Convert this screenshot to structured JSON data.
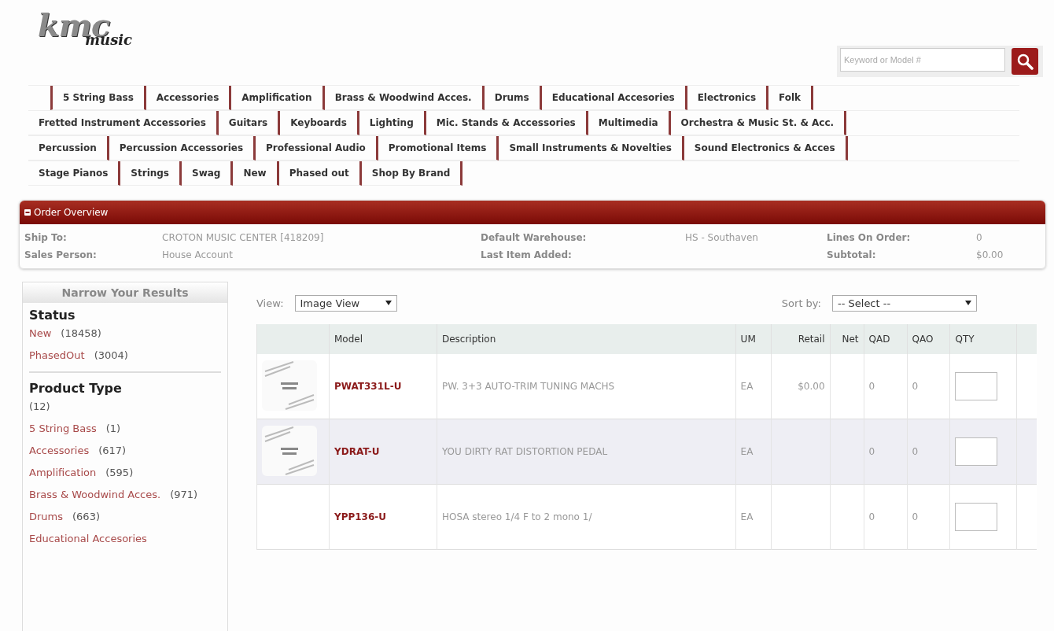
{
  "logo": {
    "main": "kmc",
    "sub": "music"
  },
  "search": {
    "placeholder": "Keyword or Model #"
  },
  "nav": {
    "items": [
      {
        "label": "5 String Bass",
        "new_line": true
      },
      {
        "label": "Accessories",
        "new_line": false
      },
      {
        "label": "Amplification",
        "new_line": false
      },
      {
        "label": "Brass & Woodwind Acces.",
        "new_line": false
      },
      {
        "label": "Drums",
        "new_line": false
      },
      {
        "label": "Educational Accesories",
        "new_line": false
      },
      {
        "label": "Electronics",
        "new_line": false
      },
      {
        "label": "Folk",
        "new_line": false
      },
      {
        "label": "Fretted Instrument Accessories",
        "new_line": true
      },
      {
        "label": "Guitars",
        "new_line": false
      },
      {
        "label": "Keyboards",
        "new_line": false
      },
      {
        "label": "Lighting",
        "new_line": false
      },
      {
        "label": "Mic. Stands & Accessories",
        "new_line": false
      },
      {
        "label": "Multimedia",
        "new_line": false
      },
      {
        "label": "Orchestra & Music St. & Acc.",
        "new_line": false
      },
      {
        "label": "Percussion",
        "new_line": true
      },
      {
        "label": "Percussion Accessories",
        "new_line": false
      },
      {
        "label": "Professional Audio",
        "new_line": false
      },
      {
        "label": "Promotional Items",
        "new_line": false
      },
      {
        "label": "Small Instruments & Novelties",
        "new_line": false
      },
      {
        "label": "Sound Electronics & Acces",
        "new_line": false
      },
      {
        "label": "Stage Pianos",
        "new_line": true
      },
      {
        "label": "Strings",
        "new_line": false
      },
      {
        "label": "Swag",
        "new_line": false
      },
      {
        "label": "New",
        "new_line": false
      },
      {
        "label": "Phased out",
        "new_line": false
      },
      {
        "label": "Shop By Brand",
        "new_line": false
      }
    ]
  },
  "order_overview": {
    "title": "Order Overview",
    "expanded": true,
    "fields": [
      {
        "label": "Ship To:",
        "value": "CROTON MUSIC CENTER [418209]"
      },
      {
        "label": "Default Warehouse:",
        "value": "HS - Southaven"
      },
      {
        "label": "Lines On Order:",
        "value": "0"
      },
      {
        "label": "Sales Person:",
        "value": "House Account"
      },
      {
        "label": "Last Item Added:"
      },
      {
        "label": "Subtotal:",
        "value": "$0.00"
      }
    ]
  },
  "sidebar": {
    "title": "Narrow Your Results",
    "groups": [
      {
        "heading": "Status",
        "items": [
          {
            "label": "New",
            "count": "(18458)"
          },
          {
            "label": "PhasedOut",
            "count": "(3004)"
          }
        ]
      },
      {
        "heading": "Product Type",
        "count": "(12)",
        "items": [
          {
            "label": "5 String Bass",
            "count": "(1)"
          },
          {
            "label": "Accessories",
            "count": "(617)"
          },
          {
            "label": "Amplification",
            "count": "(595)"
          },
          {
            "label": "Brass & Woodwind Acces.",
            "count": "(971)"
          },
          {
            "label": "Drums",
            "count": "(663)"
          },
          {
            "label": "Educational Accesories"
          }
        ]
      }
    ]
  },
  "toolbar": {
    "view_label": "View:",
    "view_value": "Image View",
    "sort_label": "Sort by:",
    "sort_value": "-- Select --"
  },
  "table": {
    "columns": [
      "",
      "Model",
      "Description",
      "UM",
      "Retail",
      "Net",
      "QAD",
      "QAO",
      "QTY",
      ""
    ],
    "rows": [
      {
        "thumbnail": true,
        "highlighted": false,
        "model": "PWAT331L-U",
        "description": "PW. 3+3 AUTO-TRIM TUNING MACHS",
        "um": "EA",
        "retail": "$0.00",
        "net": "",
        "qad": "0",
        "qao": "0"
      },
      {
        "thumbnail": true,
        "highlighted": true,
        "model": "YDRAT-U",
        "description": "YOU DIRTY RAT DISTORTION PEDAL",
        "um": "EA",
        "retail": "",
        "net": "",
        "qad": "0",
        "qao": "0"
      },
      {
        "thumbnail": false,
        "highlighted": false,
        "model": "YPP136-U",
        "description": "HOSA stereo 1/4 F to 2 mono 1/",
        "um": "EA",
        "retail": "",
        "net": "",
        "qad": "0",
        "qao": "0"
      }
    ]
  }
}
